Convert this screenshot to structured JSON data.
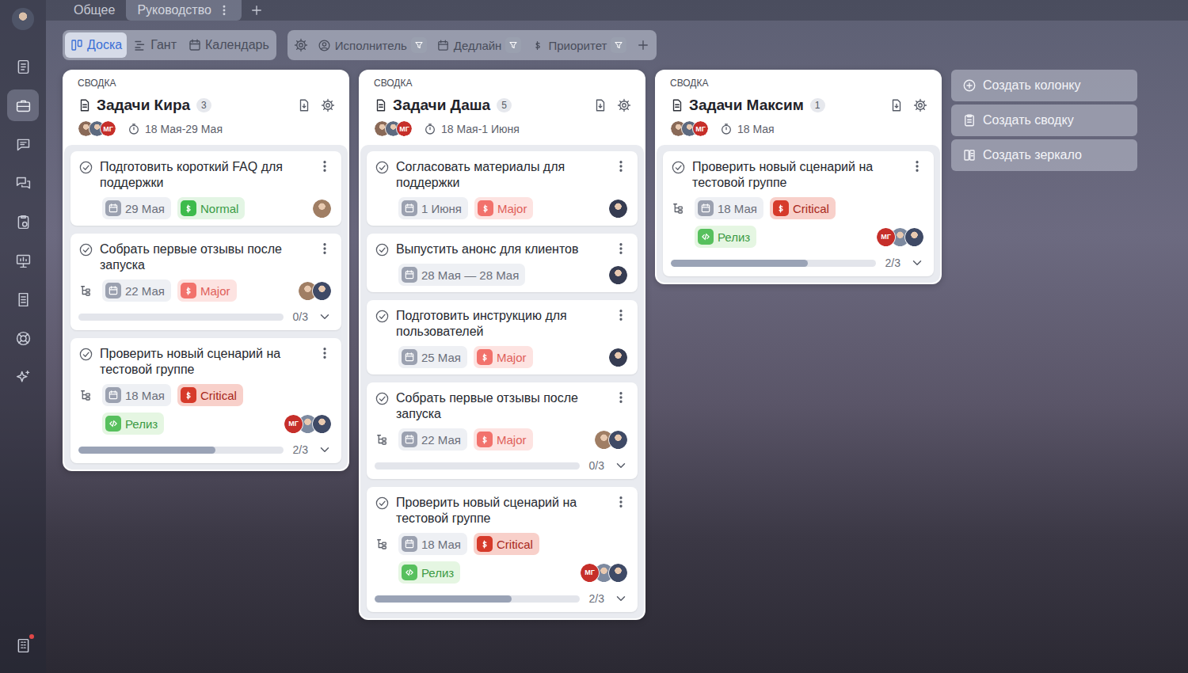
{
  "sidebar": {
    "items": [
      {
        "kind": "avatar",
        "selected": false,
        "badge": false,
        "color": "#4f5568"
      },
      {
        "kind": "tasks",
        "selected": false,
        "badge": false
      },
      {
        "kind": "briefcase",
        "selected": true,
        "badge": false
      },
      {
        "kind": "chat",
        "selected": false,
        "badge": false
      },
      {
        "kind": "chats",
        "selected": false,
        "badge": false
      },
      {
        "kind": "clipboard",
        "selected": false,
        "badge": false
      },
      {
        "kind": "presentation",
        "selected": false,
        "badge": false
      },
      {
        "kind": "document",
        "selected": false,
        "badge": false
      },
      {
        "kind": "lifebuoy",
        "selected": false,
        "badge": false
      },
      {
        "kind": "sparkle",
        "selected": false,
        "badge": false
      },
      {
        "kind": "building",
        "selected": false,
        "badge": true
      }
    ]
  },
  "tabs": [
    {
      "label": "Общее",
      "selected": false
    },
    {
      "label": "Руководство",
      "selected": true
    }
  ],
  "views": [
    {
      "label": "Доска",
      "kind": "board",
      "selected": true
    },
    {
      "label": "Гант",
      "kind": "gantt",
      "selected": false
    },
    {
      "label": "Календарь",
      "kind": "calendar",
      "selected": false
    }
  ],
  "filters": [
    {
      "label": "Исполнитель",
      "kind": "user"
    },
    {
      "label": "Дедлайн",
      "kind": "calendar"
    },
    {
      "label": "Приоритет",
      "kind": "dollar"
    }
  ],
  "columns": [
    {
      "label": "СВОДКА",
      "title": "Задачи Кира",
      "count": "3",
      "dates": "18 Мая-29 Мая",
      "avatars": [
        {
          "kind": "photo",
          "color": "#8a6a58"
        },
        {
          "kind": "photo",
          "color": "#5d6a80"
        },
        {
          "kind": "initials",
          "initials": "МГ",
          "color": "#c62f2a"
        }
      ],
      "cards": [
        {
          "title": "Подготовить короткий FAQ для поддержки",
          "subtasks": false,
          "date": "29 Мая",
          "priority": {
            "label": "Normal",
            "kind": "normal",
            "color": "#3dbb4c"
          },
          "assignees": [
            {
              "kind": "photo",
              "color": "#a07e64"
            }
          ]
        },
        {
          "title": "Собрать первые отзывы после запуска",
          "subtasks": true,
          "date": "22 Мая",
          "priority": {
            "label": "Major",
            "kind": "major",
            "color": "#f2726c"
          },
          "assignees": [
            {
              "kind": "photo",
              "color": "#a07e64"
            },
            {
              "kind": "photo",
              "color": "#3f4a66"
            }
          ],
          "progress": {
            "level": 0,
            "reading": "0/3",
            "expanded": false
          }
        },
        {
          "title": "Проверить новый сценарий на тестовой группе",
          "subtasks": true,
          "date": "18 Мая",
          "priority": {
            "label": "Critical",
            "kind": "critical",
            "color": "#d63a2a"
          },
          "tag": {
            "label": "Релиз",
            "color": "#57c05d"
          },
          "assignees": [
            {
              "kind": "initials",
              "initials": "МГ",
              "color": "#c62f2a"
            },
            {
              "kind": "photo",
              "color": "#7d8aa0"
            },
            {
              "kind": "photo",
              "color": "#3f4a66"
            }
          ],
          "progress": {
            "level": 0.67,
            "reading": "2/3",
            "expanded": false
          }
        }
      ]
    },
    {
      "label": "СВОДКА",
      "title": "Задачи Даша",
      "count": "5",
      "dates": "18 Мая-1 Июня",
      "avatars": [
        {
          "kind": "photo",
          "color": "#8a6a58"
        },
        {
          "kind": "photo",
          "color": "#5d6a80"
        },
        {
          "kind": "initials",
          "initials": "МГ",
          "color": "#c62f2a"
        }
      ],
      "cards": [
        {
          "title": "Согласовать материалы для поддержки",
          "subtasks": false,
          "date": "1 Июня",
          "priority": {
            "label": "Major",
            "kind": "major",
            "color": "#f2726c"
          },
          "assignees": [
            {
              "kind": "photo",
              "color": "#363c52"
            }
          ]
        },
        {
          "title": "Выпустить анонс для клиентов",
          "subtasks": false,
          "date": "28 Мая — 28 Мая",
          "assignees": [
            {
              "kind": "photo",
              "color": "#363c52"
            }
          ]
        },
        {
          "title": "Подготовить инструкцию для пользователей",
          "subtasks": false,
          "date": "25 Мая",
          "priority": {
            "label": "Major",
            "kind": "major",
            "color": "#f2726c"
          },
          "assignees": [
            {
              "kind": "photo",
              "color": "#363c52"
            }
          ]
        },
        {
          "title": "Собрать первые отзывы после запуска",
          "subtasks": true,
          "date": "22 Мая",
          "priority": {
            "label": "Major",
            "kind": "major",
            "color": "#f2726c"
          },
          "assignees": [
            {
              "kind": "photo",
              "color": "#a07e64"
            },
            {
              "kind": "photo",
              "color": "#3f4a66"
            }
          ],
          "progress": {
            "level": 0,
            "reading": "0/3",
            "expanded": false
          }
        },
        {
          "title": "Проверить новый сценарий на тестовой группе",
          "subtasks": true,
          "date": "18 Мая",
          "priority": {
            "label": "Critical",
            "kind": "critical",
            "color": "#d63a2a"
          },
          "tag": {
            "label": "Релиз",
            "color": "#57c05d"
          },
          "assignees": [
            {
              "kind": "initials",
              "initials": "МГ",
              "color": "#c62f2a"
            },
            {
              "kind": "photo",
              "color": "#7d8aa0"
            },
            {
              "kind": "photo",
              "color": "#3f4a66"
            }
          ],
          "progress": {
            "level": 0.67,
            "reading": "2/3",
            "expanded": false
          }
        }
      ]
    },
    {
      "label": "СВОДКА",
      "title": "Задачи Максим",
      "count": "1",
      "dates": "18 Мая",
      "avatars": [
        {
          "kind": "photo",
          "color": "#8a6a58"
        },
        {
          "kind": "photo",
          "color": "#5d6a80"
        },
        {
          "kind": "initials",
          "initials": "МГ",
          "color": "#c62f2a"
        }
      ],
      "cards": [
        {
          "title": "Проверить новый сценарий на тестовой группе",
          "subtasks": true,
          "date": "18 Мая",
          "priority": {
            "label": "Critical",
            "kind": "critical",
            "color": "#d63a2a"
          },
          "tag": {
            "label": "Релиз",
            "color": "#57c05d"
          },
          "assignees": [
            {
              "kind": "initials",
              "initials": "МГ",
              "color": "#c62f2a"
            },
            {
              "kind": "photo",
              "color": "#7d8aa0"
            },
            {
              "kind": "photo",
              "color": "#3f4a66"
            }
          ],
          "progress": {
            "level": 0.67,
            "reading": "2/3",
            "expanded": false
          }
        }
      ]
    }
  ],
  "actions": [
    {
      "label": "Создать колонку",
      "kind": "add"
    },
    {
      "label": "Создать сводку",
      "kind": "summary"
    },
    {
      "label": "Создать зеркало",
      "kind": "mirror"
    }
  ]
}
